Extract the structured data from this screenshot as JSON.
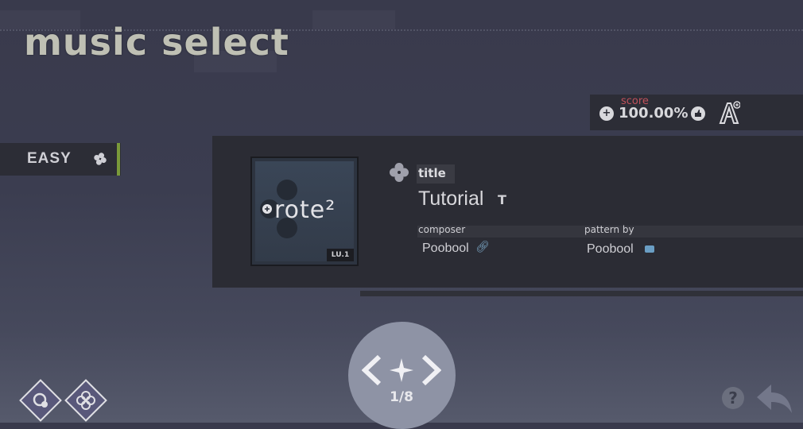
{
  "header": {
    "title": "music select"
  },
  "score": {
    "label": "score",
    "value": "100.00%"
  },
  "difficulty": {
    "label": "EASY"
  },
  "song": {
    "jacket_title": "rote²",
    "jacket_badge": "LU.1",
    "title_label": "title",
    "title": "Tutorial",
    "composer_label": "composer",
    "composer": "Poobool",
    "pattern_label": "pattern by",
    "pattern_by": "Poobool"
  },
  "navigator": {
    "page": "1/8"
  },
  "icons": {
    "score_left": "plus-circle-icon",
    "score_mid": "thumb-circle-icon",
    "rank": "rank-a-plus-icon",
    "help": "question-icon",
    "back": "back-arrow-icon"
  },
  "help_glyph": "?",
  "colors": {
    "accent_easy": "#7a9a3a",
    "score_label": "#c0505a",
    "link": "#7aa6c4"
  }
}
